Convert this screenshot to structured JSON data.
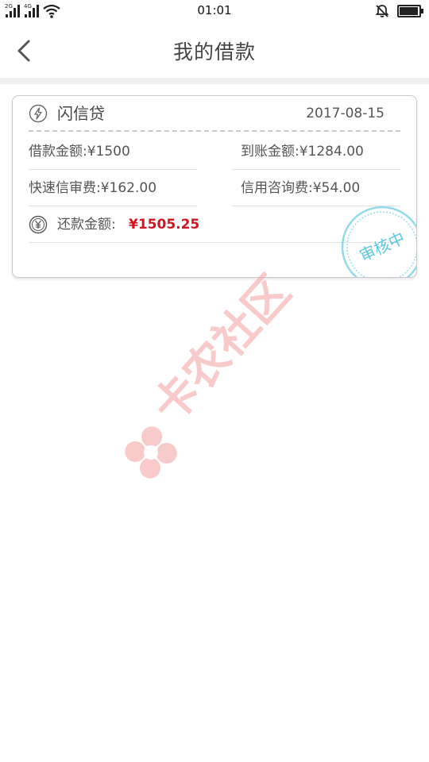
{
  "status_bar": {
    "network_1": "2G",
    "network_2": "4G",
    "time": "01:01",
    "battery_level": 0.95,
    "icons": [
      "signal-icon",
      "wifi-icon",
      "alarm-off-icon",
      "battery-icon"
    ]
  },
  "header": {
    "title": "我的借款",
    "back_icon": "chevron-left-icon"
  },
  "loan": {
    "product_name": "闪信贷",
    "date": "2017-08-15",
    "loan_amount_label": "借款金额:",
    "loan_amount_value": "¥1500",
    "received_amount_label": "到账金额:",
    "received_amount_value": "¥1284.00",
    "quick_review_fee_label": "快速信审费:",
    "quick_review_fee_value": "¥162.00",
    "credit_consult_fee_label": "信用咨询费:",
    "credit_consult_fee_value": "¥54.00",
    "repay_amount_label": "还款金额:",
    "repay_amount_value": "¥1505.25",
    "stamp_text": "审核中"
  },
  "watermark": {
    "text": "卡农社区"
  },
  "colors": {
    "accent_red": "#d2141e",
    "stamp_blue": "#5ac8e0",
    "watermark_pink": "#f4a0a0",
    "divider": "#efefef"
  }
}
